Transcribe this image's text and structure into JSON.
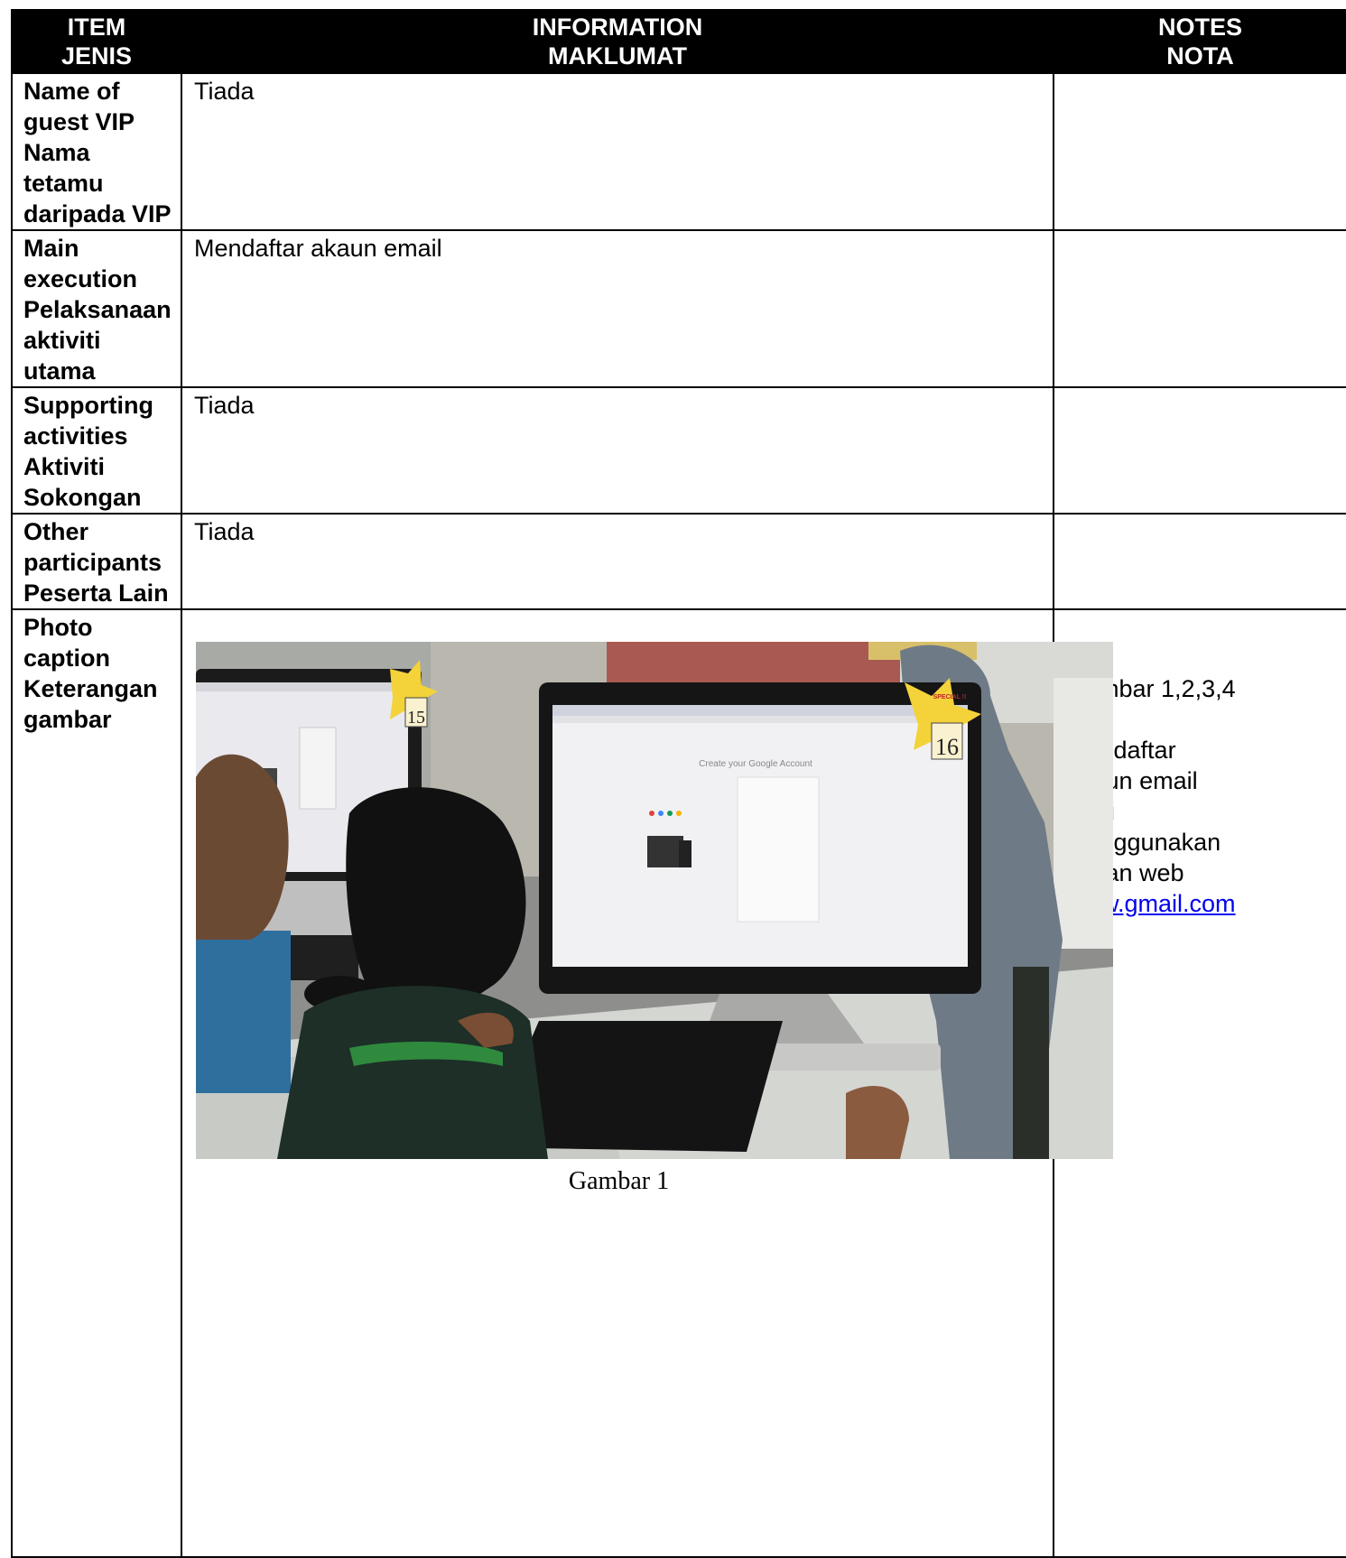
{
  "header": {
    "col1_en": "ITEM",
    "col1_ms": "JENIS",
    "col2_en": "INFORMATION",
    "col2_ms": "MAKLUMAT",
    "col3_en": "NOTES",
    "col3_ms": "NOTA"
  },
  "rows": [
    {
      "label_lines": [
        "Name of",
        "guest VIP",
        "Nama",
        "tetamu",
        "daripada VIP"
      ],
      "info": "Tiada",
      "notes": ""
    },
    {
      "label_lines": [
        "Main",
        "execution",
        "Pelaksanaan",
        "aktiviti",
        "utama"
      ],
      "info": "Mendaftar akaun email",
      "notes": ""
    },
    {
      "label_lines": [
        "Supporting",
        "activities",
        "Aktiviti",
        "Sokongan"
      ],
      "info": "Tiada",
      "notes": ""
    },
    {
      "label_lines": [
        "Other",
        "participants",
        "Peserta Lain"
      ],
      "info": "Tiada",
      "notes": ""
    }
  ],
  "photo_row": {
    "label_lines": [
      "Photo",
      "caption",
      "Keterangan",
      "gambar"
    ],
    "photo_caption": "Gambar 1",
    "screen_title": "Create your Google Account",
    "sticker_left": "15",
    "sticker_right": "16",
    "sticker_badge": "SPECIAL !!",
    "notes_lines": [
      "Gambar 1,2,3,4",
      ":",
      "Mendaftar",
      "akaun email",
      "baru",
      "menggunakan",
      "laman web"
    ],
    "notes_link": "www.gmail.com"
  },
  "colors": {
    "header_bg": "#000000",
    "header_text": "#ffffff",
    "link": "#0000ee"
  }
}
